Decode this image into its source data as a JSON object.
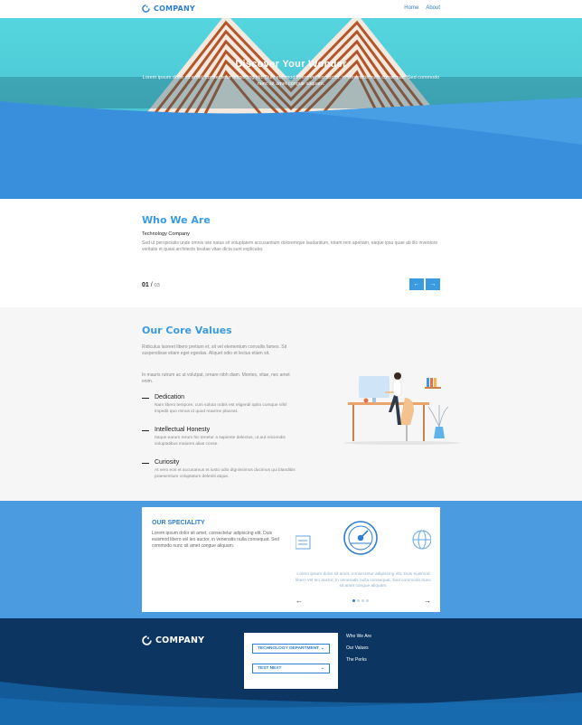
{
  "nav": {
    "brand": "COMPANY",
    "links": [
      "Home",
      "About"
    ]
  },
  "hero": {
    "title": "Discover Your Wonder",
    "subtitle": "Lorem ipsum dolor sit amet, consectetur adipiscing elit. Duis euismod libero vel leo auctor, in venenatis nulla consequat. Sed commodo nunc sit amet congue aliquam."
  },
  "who": {
    "title": "Who We Are",
    "subtitle": "Technology Company",
    "paragraph": "Sed ut perspiciatis unde omnis iste natus sit voluptatem accusantium doloremque laudantium, totam rem aperiam, eaque ipsa quae ab illo inventore veritatis et quasi architecto beatae vitae dicta sunt explicabo.",
    "counter_current": "01",
    "counter_sep": " / ",
    "counter_total": "03",
    "prev_label": "←",
    "next_label": "→"
  },
  "core": {
    "title": "Our Core Values",
    "intro1": "Ridiculus laoreet libero pretium et, sit vel elementum convallis fames. Sit suspendisse etiam eget egestas. Aliquet odio et lectus etiam sit.",
    "intro2": "In mauris rutrum ac ut volutpat, ornare nibh diam. Montes, vitae, nec amet enim.",
    "values": [
      {
        "title": "Dedication",
        "desc": "Nam libero tempore, cum soluta nobis est eligendi optio cumque nihil impedit quo minus id quod maxime placeat."
      },
      {
        "title": "Intellectual Honesty",
        "desc": "Itaque earum rerum hic tenetur a sapiente delectus, ut aut reiciendis voluptatibus maiores alias conse."
      },
      {
        "title": "Curiosity",
        "desc": "At vero eos et accusamus et iusto odio dignissimos ducimus qui blanditiis praesentium voluptatum deleniti atque."
      }
    ]
  },
  "speciality": {
    "title": "OUR SPECIALITY",
    "text": "Lorem ipsum dolor sit amet, consectetur adipiscing elit. Duis euismod libero vel leo auctor, in venenatis nulla consequat. Sed commodo nunc sit amet congue aliquam.",
    "carousel_text": "Lorem ipsum dolor sit amet, consectetur adipiscing elit. Duis euismod libero vel leo auctor, in venenatis nulla consequat. Sed commodo nunc sit amet congue aliquam.",
    "prev_label": "←",
    "next_label": "→",
    "active_dot": 0
  },
  "footer": {
    "brand": "COMPANY",
    "select1": "TECHNOLOGY DEPARTMENT",
    "select2": "TEST NEXT",
    "links": [
      "Who We Are",
      "Our Values",
      "The Perks"
    ]
  },
  "colors": {
    "brand_blue": "#2f7fd0",
    "accent_blue": "#3a9be0",
    "hero_sky": "#4dd0dc",
    "section_blue": "#4a9be0",
    "footer_navy": "#0c3561"
  }
}
